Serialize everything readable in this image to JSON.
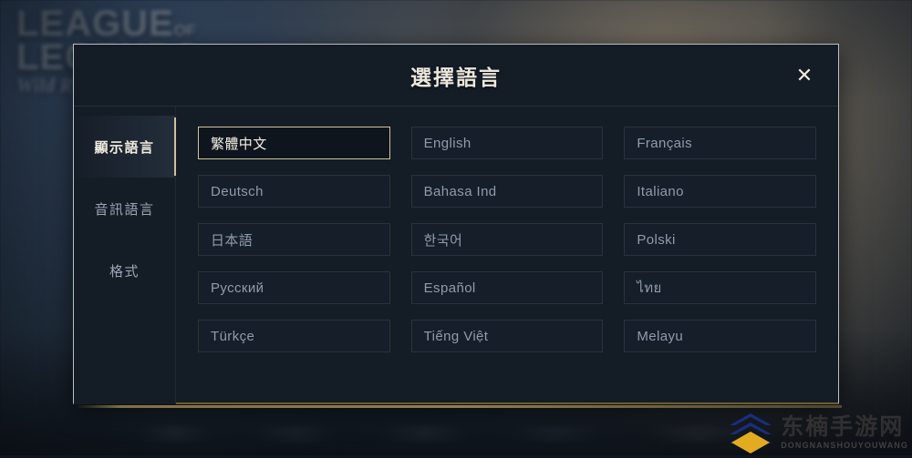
{
  "background": {
    "logo_line1": "LEAGUE",
    "logo_of": "OF",
    "logo_line2": "LEGENDS",
    "logo_subtitle": "Wild Rift"
  },
  "dialog": {
    "title": "選擇語言",
    "close_icon": "close-icon",
    "close_glyph": "✕",
    "sidebar": {
      "items": [
        {
          "label": "顯示語言",
          "selected": true
        },
        {
          "label": "音訊語言",
          "selected": false
        },
        {
          "label": "格式",
          "selected": false
        }
      ]
    },
    "languages": [
      {
        "label": "繁體中文",
        "selected": true
      },
      {
        "label": "English",
        "selected": false
      },
      {
        "label": "Français",
        "selected": false
      },
      {
        "label": "Deutsch",
        "selected": false
      },
      {
        "label": "Bahasa Ind",
        "selected": false
      },
      {
        "label": "Italiano",
        "selected": false
      },
      {
        "label": "日本語",
        "selected": false
      },
      {
        "label": "한국어",
        "selected": false
      },
      {
        "label": "Polski",
        "selected": false
      },
      {
        "label": "Русский",
        "selected": false
      },
      {
        "label": "Español",
        "selected": false
      },
      {
        "label": "ไทย",
        "selected": false
      },
      {
        "label": "Türkçe",
        "selected": false
      },
      {
        "label": "Tiếng Việt",
        "selected": false
      },
      {
        "label": "Melayu",
        "selected": false
      }
    ]
  },
  "watermark": {
    "name_cn": "东楠手游网",
    "name_en": "DONGNANSHOUYOUWANG",
    "logo_icon": "chevron-diamond-logo-icon",
    "chevron_color": "#1b2f86",
    "diamond_color": "#f5b921"
  },
  "colors": {
    "accent_gold": "#cfc49f",
    "dialog_bg": "#141c26",
    "text_muted": "#8e9cac",
    "text_bright": "#f4f0e6"
  }
}
